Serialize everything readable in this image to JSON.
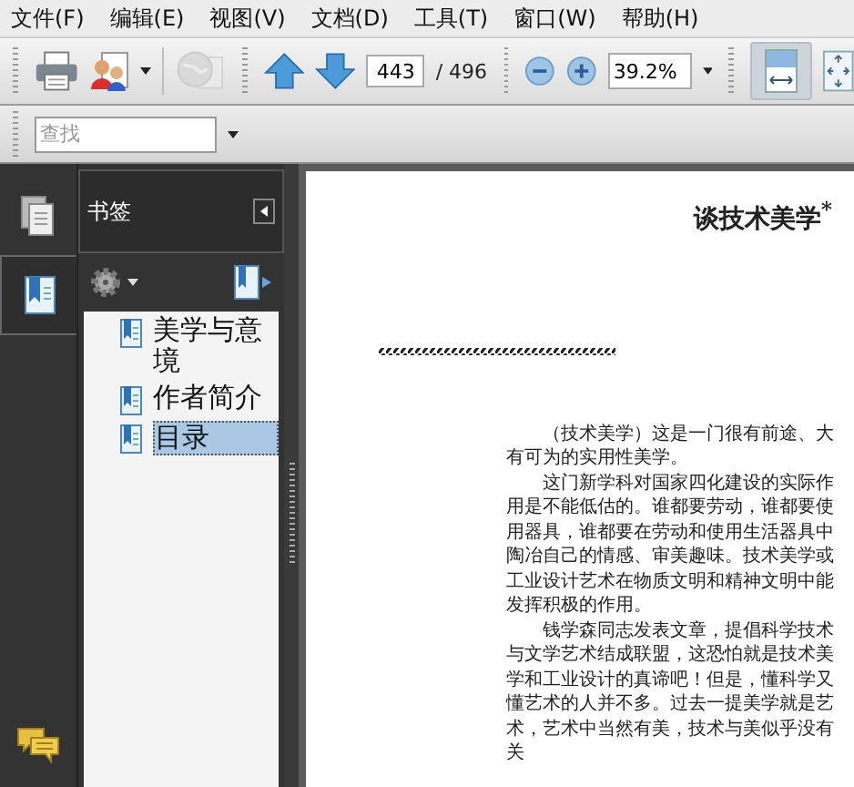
{
  "menu_bar": [
    "文件(F)",
    "编辑(E)",
    "视图(V)",
    "文档(D)",
    "工具(T)",
    "窗口(W)",
    "帮助(H)"
  ],
  "toolbar": {
    "page_number": "443",
    "page_count": "/ 496",
    "zoom": "39.2%",
    "fit_width_pressed": true,
    "share_disabled": true
  },
  "find_bar": {
    "placeholder": "查找"
  },
  "nav_rail": [
    {
      "kind": "pages",
      "selected": false
    },
    {
      "kind": "bookmarks",
      "selected": true
    }
  ],
  "bookmarks_panel": {
    "title": "书签",
    "items": [
      {
        "label": "美学与意境",
        "selected": false
      },
      {
        "label": "作者简介",
        "selected": false
      },
      {
        "label": "目录",
        "selected": true
      }
    ]
  },
  "document": {
    "title": "谈技术美学$^{*}$",
    "paragraphs": [
      "（技术美学）这是一门很有前途、大有可为的实用性美学。",
      "这门新学科对国家四化建设的实际作用是不能低估的。谁都要劳动，谁都要使用器具，谁都要在劳动和使用生活器具中陶冶自己的情感、审美趣味。技术美学或工业设计艺术在物质文明和精神文明中能发挥积极的作用。",
      "钱学森同志发表文章，提倡科学技术与文学艺术结成联盟，这恐怕就是技术美学和工业设计的真谛吧！但是，懂科学又懂艺术的人并不多。过去一提美学就是艺术，艺术中当然有美，技术与美似乎没有关"
    ]
  }
}
